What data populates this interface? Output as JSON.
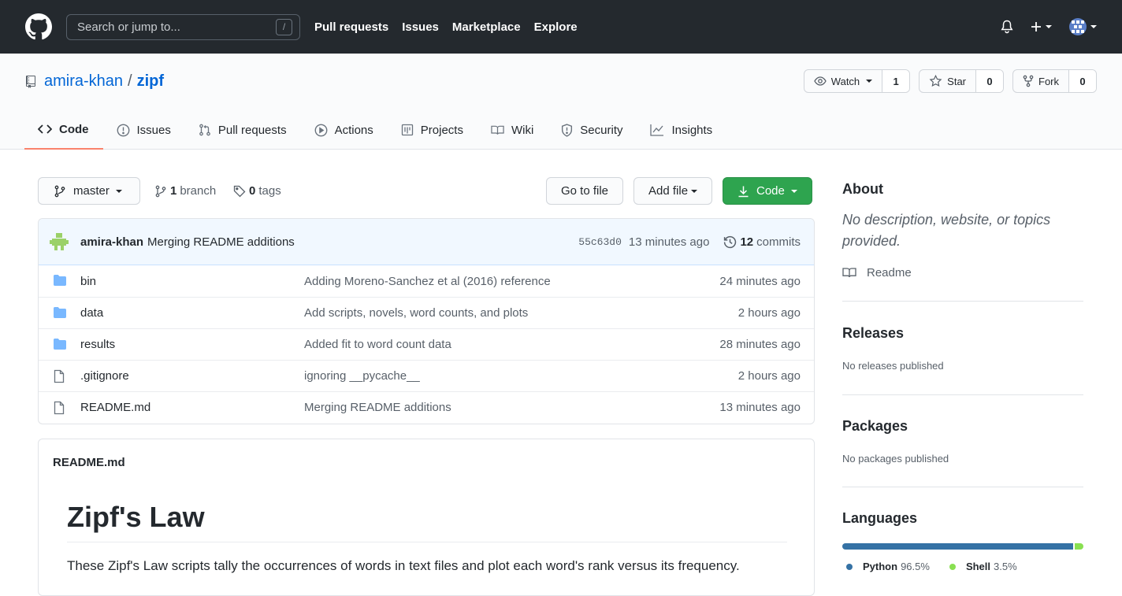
{
  "header": {
    "search_placeholder": "Search or jump to...",
    "search_shortcut": "/",
    "nav": [
      "Pull requests",
      "Issues",
      "Marketplace",
      "Explore"
    ]
  },
  "repo": {
    "owner": "amira-khan",
    "separator": "/",
    "name": "zipf",
    "watch": {
      "label": "Watch",
      "count": "1"
    },
    "star": {
      "label": "Star",
      "count": "0"
    },
    "fork": {
      "label": "Fork",
      "count": "0"
    },
    "tabs": [
      "Code",
      "Issues",
      "Pull requests",
      "Actions",
      "Projects",
      "Wiki",
      "Security",
      "Insights"
    ]
  },
  "branchbar": {
    "branch": "master",
    "branch_count": "1",
    "branch_label": "branch",
    "tag_count": "0",
    "tag_label": "tags",
    "go_to_file": "Go to file",
    "add_file": "Add file",
    "code": "Code"
  },
  "commit": {
    "author": "amira-khan",
    "message": "Merging README additions",
    "sha": "55c63d0",
    "age": "13 minutes ago",
    "count": "12",
    "count_label": "commits"
  },
  "files": [
    {
      "type": "folder",
      "name": "bin",
      "message": "Adding Moreno-Sanchez et al (2016) reference",
      "age": "24 minutes ago"
    },
    {
      "type": "folder",
      "name": "data",
      "message": "Add scripts, novels, word counts, and plots",
      "age": "2 hours ago"
    },
    {
      "type": "folder",
      "name": "results",
      "message": "Added fit to word count data",
      "age": "28 minutes ago"
    },
    {
      "type": "file",
      "name": ".gitignore",
      "message": "ignoring __pycache__",
      "age": "2 hours ago"
    },
    {
      "type": "file",
      "name": "README.md",
      "message": "Merging README additions",
      "age": "13 minutes ago"
    }
  ],
  "readme": {
    "filename": "README.md",
    "title": "Zipf's Law",
    "intro": "These Zipf's Law scripts tally the occurrences of words in text files and plot each word's rank versus its frequency."
  },
  "sidebar": {
    "about_title": "About",
    "about_desc": "No description, website, or topics provided.",
    "readme_link": "Readme",
    "releases_title": "Releases",
    "releases_text": "No releases published",
    "packages_title": "Packages",
    "packages_text": "No packages published",
    "languages_title": "Languages",
    "languages": [
      {
        "name": "Python",
        "percent": "96.5%",
        "value": 96.5,
        "color": "#3572A5"
      },
      {
        "name": "Shell",
        "percent": "3.5%",
        "value": 3.5,
        "color": "#89e051"
      }
    ]
  },
  "colors": {
    "header_bg": "#24292e",
    "link": "#0366d6",
    "primary_button": "#2ea44f",
    "active_tab_underline": "#f9826c",
    "folder_icon": "#79b8ff"
  }
}
